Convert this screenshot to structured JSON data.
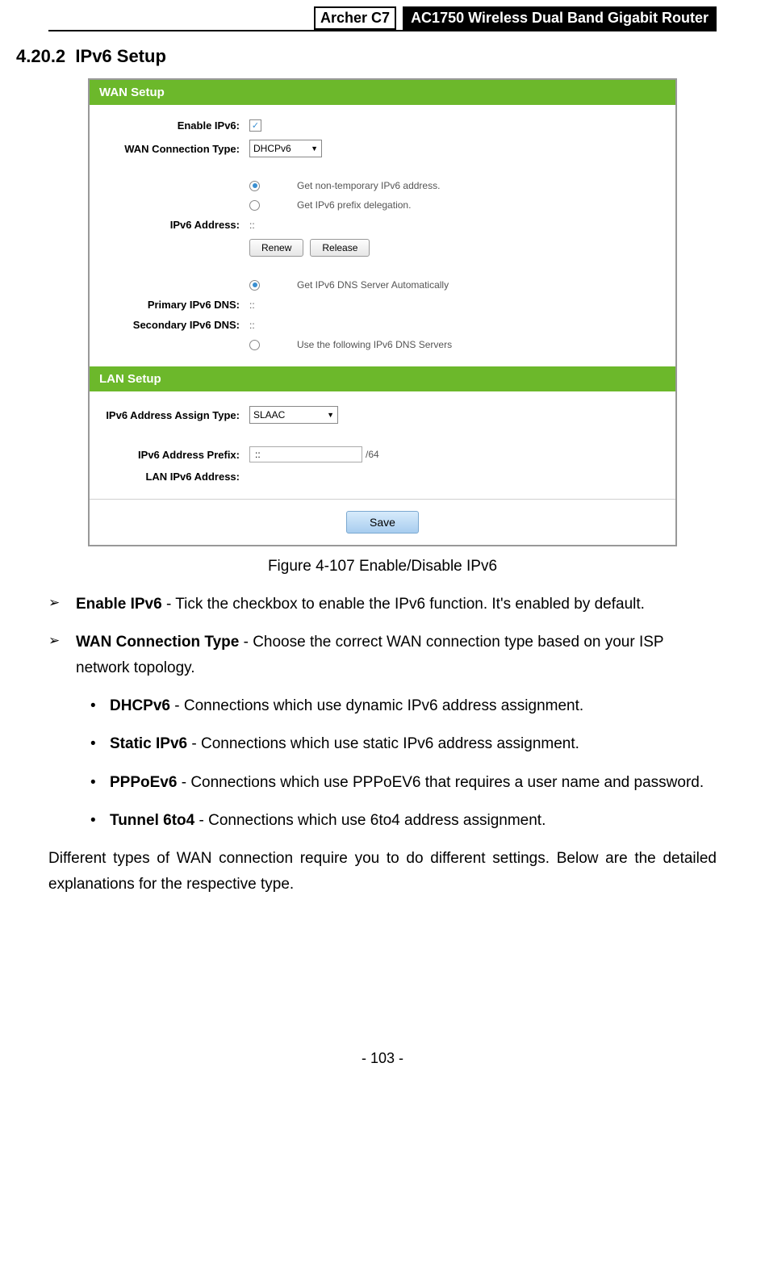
{
  "header": {
    "model": "Archer C7",
    "product": "AC1750 Wireless Dual Band Gigabit Router"
  },
  "section": {
    "number": "4.20.2",
    "title": "IPv6 Setup"
  },
  "ui": {
    "wan_header": "WAN Setup",
    "lan_header": "LAN Setup",
    "labels": {
      "enable_ipv6": "Enable IPv6:",
      "wan_conn_type": "WAN Connection Type:",
      "ipv6_address": "IPv6 Address:",
      "primary_dns": "Primary IPv6 DNS:",
      "secondary_dns": "Secondary IPv6 DNS:",
      "assign_type": "IPv6 Address Assign Type:",
      "prefix": "IPv6 Address Prefix:",
      "lan_ipv6": "LAN IPv6 Address:"
    },
    "values": {
      "wan_conn_type": "DHCPv6",
      "ipv6_address": "::",
      "primary_dns": "::",
      "secondary_dns": "::",
      "assign_type": "SLAAC",
      "prefix": "::",
      "prefix_suffix": "/64",
      "check": "✓"
    },
    "opts": {
      "nontemp": "Get non-temporary IPv6 address.",
      "prefix_delegation": "Get IPv6 prefix delegation.",
      "dns_auto": "Get IPv6 DNS Server Automatically",
      "dns_manual": "Use the following IPv6 DNS Servers"
    },
    "buttons": {
      "renew": "Renew",
      "release": "Release",
      "save": "Save"
    }
  },
  "caption": "Figure 4-107 Enable/Disable IPv6",
  "bullets": {
    "enable_title": "Enable IPv6",
    "enable_text": " - Tick the checkbox to enable the IPv6 function. It's enabled by default.",
    "wan_title": "WAN Connection Type",
    "wan_text": " - Choose the correct WAN connection type based on your ISP network topology.",
    "dhcp_title": "DHCPv6",
    "dhcp_text": " - Connections which use dynamic IPv6 address assignment.",
    "static_title": "Static IPv6",
    "static_text": " - Connections which use static IPv6 address assignment.",
    "pppoe_title": "PPPoEv6",
    "pppoe_text": " - Connections which use PPPoEV6 that requires a user name and password.",
    "tunnel_title": "Tunnel 6to4",
    "tunnel_text": " - Connections which use 6to4 address assignment."
  },
  "paragraph": "Different types of WAN connection require you to do different settings. Below are the detailed explanations for the respective type.",
  "footer": "- 103 -"
}
